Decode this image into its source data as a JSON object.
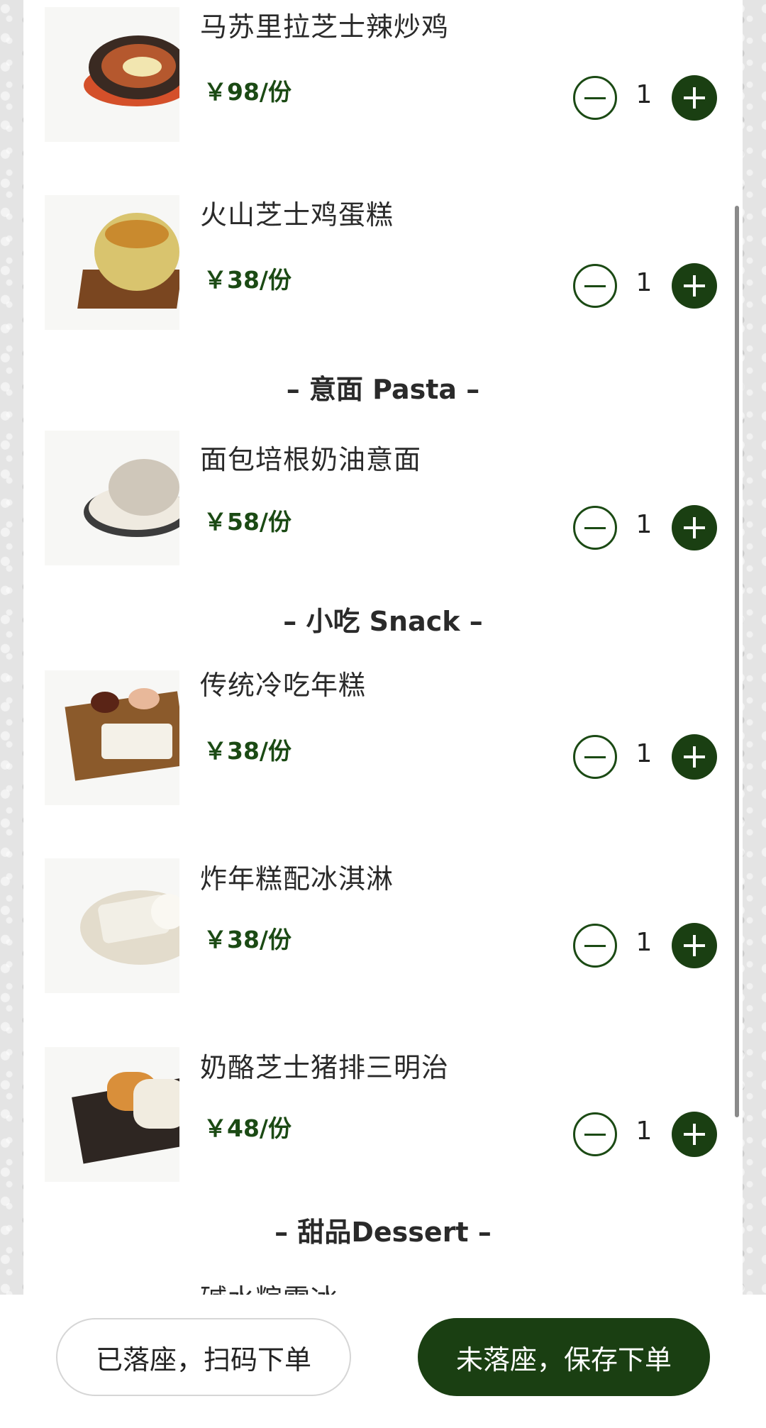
{
  "menu": {
    "items": [
      {
        "name": "马苏里拉芝士辣炒鸡",
        "price": "￥98/份",
        "qty": "1",
        "image": "cheese-spicy-chicken-image"
      },
      {
        "name": "火山芝士鸡蛋糕",
        "price": "￥38/份",
        "qty": "1",
        "image": "volcano-cheese-egg-cake-image"
      },
      {
        "name": "面包培根奶油意面",
        "price": "￥58/份",
        "qty": "1",
        "image": "bread-bacon-cream-pasta-image"
      },
      {
        "name": "传统冷吃年糕",
        "price": "￥38/份",
        "qty": "1",
        "image": "cold-rice-cake-image"
      },
      {
        "name": "炸年糕配冰淇淋",
        "price": "￥38/份",
        "qty": "1",
        "image": "fried-rice-cake-ice-cream-image"
      },
      {
        "name": "奶酪芝士猪排三明治",
        "price": "￥48/份",
        "qty": "1",
        "image": "cheese-pork-cutlet-sandwich-image"
      }
    ],
    "sections": {
      "pasta": "– 意面 Pasta –",
      "snack": "– 小吃 Snack –",
      "dessert": "– 甜品Dessert –"
    },
    "partial_item": "碱水粽雪冰"
  },
  "actions": {
    "seated": "已落座，扫码下单",
    "not_seated": "未落座，保存下单"
  },
  "colors": {
    "accent": "#1a3f12",
    "price": "#1b4a14"
  },
  "icons": {
    "minus": "minus-circle-icon",
    "plus": "plus-circle-icon"
  }
}
